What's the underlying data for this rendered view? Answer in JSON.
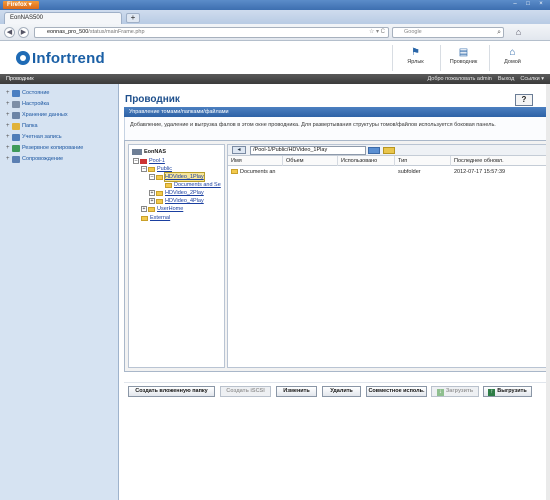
{
  "browser": {
    "menu_label": "Firefox",
    "tab_title": "EonNAS500",
    "new_tab": "+",
    "url_host": "eonnas_pro_500",
    "url_path": "/status/mainFrame.php",
    "search_placeholder": "Google",
    "win_controls": [
      "–",
      "□",
      "×"
    ]
  },
  "header": {
    "logo_text": "Infortrend",
    "buttons": [
      {
        "label": "Ярлык",
        "icon": "shortcut-icon"
      },
      {
        "label": "Проводник",
        "icon": "explorer-icon"
      },
      {
        "label": "Домой",
        "icon": "home-icon"
      }
    ]
  },
  "menu_strip": {
    "breadcrumb": "Проводник",
    "welcome": "Добро пожаловать admin",
    "logout": "Выход",
    "links": "Ссылки ▾"
  },
  "sidebar": {
    "items": [
      {
        "label": "Состояние",
        "color": "#4a7fc2"
      },
      {
        "label": "Настройка",
        "color": "#7d8ea6"
      },
      {
        "label": "Хранение данных",
        "color": "#6b84a6"
      },
      {
        "label": "Папка",
        "color": "#e0b23a"
      },
      {
        "label": "Учетная запись",
        "color": "#4f7db8"
      },
      {
        "label": "Резервное копирование",
        "color": "#3f9a5a"
      },
      {
        "label": "Сопровождение",
        "color": "#5b7fb2"
      }
    ]
  },
  "content": {
    "title": "Проводник",
    "help": "?",
    "section_title": "Управление томами/папками/файлами",
    "description": "Добавление, удаление и выгрузка фалов в этом окне проводника. Для развертывания структуры томов/файлов используется боковая панель."
  },
  "tree": {
    "root": "EonNAS",
    "pool": "Pool-1",
    "public": "Public",
    "hd1": "HDVideo_1Play",
    "docs": "Documents and Se",
    "hd2": "HDVideo_2Play",
    "hd4": "HDVideo_4Play",
    "userhome": "UserHome",
    "external": "External"
  },
  "file_pane": {
    "path": "/Pool-1/Public/HDVideo_1Play",
    "columns": [
      "Имя",
      "Объем",
      "Использовано",
      "Тип",
      "Последнее обновл."
    ],
    "rows": [
      {
        "name": "Documents an",
        "size": "",
        "used": "",
        "type": "subfolder",
        "updated": "2012-07-17 15:57:39"
      }
    ]
  },
  "buttons": {
    "create_folder": "Создать вложенную папку",
    "create_iscsi": "Создать iSCSI",
    "edit": "Изменить",
    "delete": "Удалить",
    "sharing": "Совместное исполь.",
    "download": "Загрузить",
    "upload": "Выгрузить"
  }
}
